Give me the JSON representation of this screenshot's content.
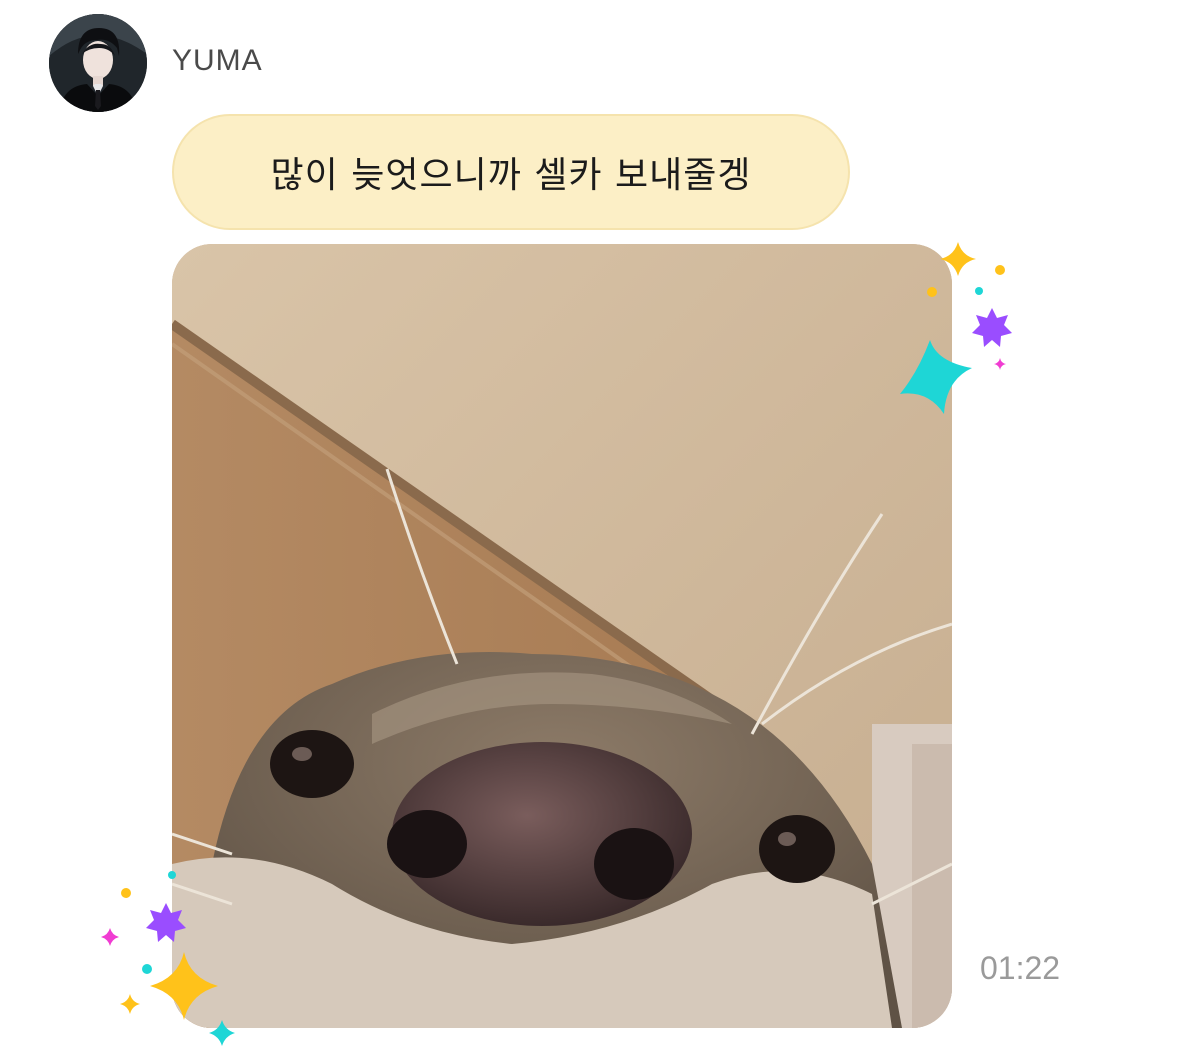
{
  "message": {
    "sender_name": "YUMA",
    "text": "많이 늦엇으니까 셀카 보내줄겡",
    "timestamp": "01:22"
  },
  "avatar": {
    "icon": "profile-photo"
  },
  "photo": {
    "icon": "otter-selfie-photo"
  },
  "colors": {
    "bubble_bg": "#fcefc6",
    "bubble_border": "#f5e3ad",
    "sparkle_yellow": "#ffc21a",
    "sparkle_purple": "#9a4dff",
    "sparkle_cyan": "#1ed6d6",
    "sparkle_pink": "#f03cd2"
  }
}
